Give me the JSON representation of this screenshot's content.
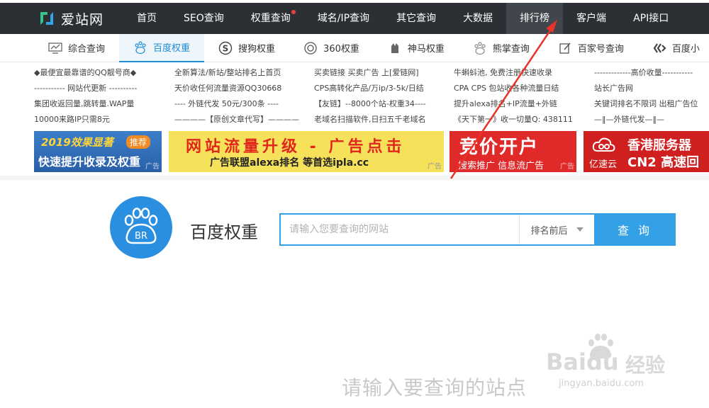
{
  "logo": {
    "text": "爱站网"
  },
  "nav": {
    "items": [
      {
        "label": "首页"
      },
      {
        "label": "SEO查询"
      },
      {
        "label": "权重查询"
      },
      {
        "label": "域名/IP查询"
      },
      {
        "label": "其它查询"
      },
      {
        "label": "大数据"
      },
      {
        "label": "排行榜"
      },
      {
        "label": "客户端"
      },
      {
        "label": "API接口"
      }
    ]
  },
  "subnav": {
    "items": [
      {
        "label": "综合查询",
        "icon": "monitor-icon"
      },
      {
        "label": "百度权重",
        "icon": "baidu-paw-icon"
      },
      {
        "label": "搜狗权重",
        "icon": "sogou-icon"
      },
      {
        "label": "360权重",
        "icon": "360-icon"
      },
      {
        "label": "神马权重",
        "icon": "shenma-icon"
      },
      {
        "label": "熊掌查询",
        "icon": "paw-icon"
      },
      {
        "label": "百家号查询",
        "icon": "edit-icon"
      },
      {
        "label": "百度小",
        "icon": "baidu-mini-icon"
      }
    ]
  },
  "ads": {
    "col1": [
      "◆最便宜最靠谱的QQ靓号商◆",
      "----------- 网站代更新 ----------",
      "集团收返回量,跳转量.WAP量",
      "10000来路IP只需8元"
    ],
    "col2": [
      "全新算法/新站/整站排名上首页",
      "天价收任何流量资源QQ30668",
      "---- 外链代发 50元/300条 ----",
      "————【原创文章代写】————"
    ],
    "col3": [
      "买卖链接 买卖广告 上[爱链网]",
      "CPS高转化产品/万ip/3-5k/日结",
      "【友链】--8000个站-权重34----",
      "老域名扫描软件,日扫五千老域名"
    ],
    "col4": [
      "牛蝌蚪池, 免费注册快速收录",
      "CPA CPS 包站收各种流量日结",
      "提升alexa排名+IP流量+外链",
      "《天下第一》收一切量Q: 438111"
    ],
    "col5": [
      "-------------高价收量-----------",
      "站长广告网",
      "关键词排名不限词 出租广告位",
      "—‖—外链代发—‖—"
    ]
  },
  "banners": {
    "b1": {
      "line1": "2019效果显著",
      "tag": "推荐",
      "line2": "快速提升收录及权重",
      "ad": "广告"
    },
    "b2": {
      "line1": "网站流量升级 - 广告点击",
      "line2": "广告联盟alexa排名 等首选ipla.cc",
      "ad": "广告"
    },
    "b3": {
      "line1": "竞价开户",
      "line2": "搜索推广 信息流广告",
      "ad": "广告"
    },
    "b4": {
      "line1": "香港服务器",
      "brand": "亿速云",
      "line2": "CN2 高速回"
    }
  },
  "main": {
    "logo_text": "BR",
    "title": "百度权重",
    "search_placeholder": "请输入您要查询的网站",
    "select_value": "排名前后",
    "query_button": "查 询",
    "hint": "请输入要查询的站点"
  },
  "watermark": {
    "brand": "Bai",
    "brand2": "du",
    "cn": "经验",
    "url": "jingyan.baidu.com"
  },
  "colors": {
    "nav_bg": "#2c3035",
    "accent": "#34a0e6",
    "arrow": "#e8332a"
  }
}
